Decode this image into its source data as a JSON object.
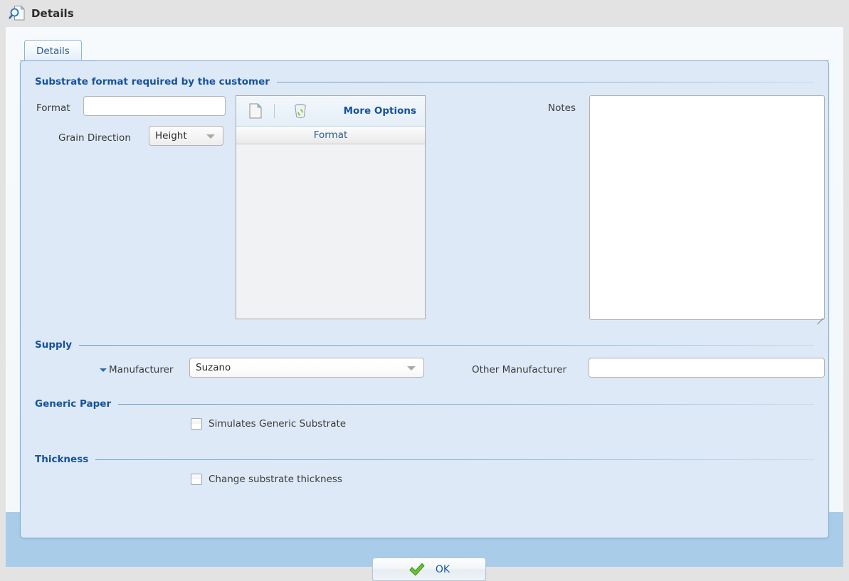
{
  "window": {
    "title": "Details",
    "title_icon": "document-search-icon"
  },
  "tabs": [
    {
      "label": "Details",
      "active": true
    }
  ],
  "sections": {
    "substrate": {
      "heading": "Substrate format required by the customer",
      "format_label": "Format",
      "format_value": "",
      "grain_direction_label": "Grain Direction",
      "grain_direction_value": "Height",
      "notes_label": "Notes",
      "notes_value": "",
      "grid": {
        "toolbar": {
          "new_icon": "new-document-icon",
          "delete_icon": "recycle-bin-icon",
          "more_options_label": "More Options"
        },
        "column_header": "Format",
        "rows": []
      }
    },
    "supply": {
      "heading": "Supply",
      "manufacturer_label": "Manufacturer",
      "manufacturer_value": "Suzano",
      "other_manufacturer_label": "Other Manufacturer",
      "other_manufacturer_value": ""
    },
    "generic_paper": {
      "heading": "Generic Paper",
      "simulates_label": "Simulates Generic Substrate",
      "simulates_checked": false
    },
    "thickness": {
      "heading": "Thickness",
      "change_label": "Change substrate thickness",
      "change_checked": false
    }
  },
  "footer": {
    "ok_label": "OK",
    "ok_icon": "green-check-icon"
  },
  "colors": {
    "heading_blue": "#16529c",
    "panel_bg": "#dde9f6",
    "window_chrome": "#a9cce9",
    "tab_border": "#7fb0d6",
    "accent_green": "#5cbb2a"
  }
}
